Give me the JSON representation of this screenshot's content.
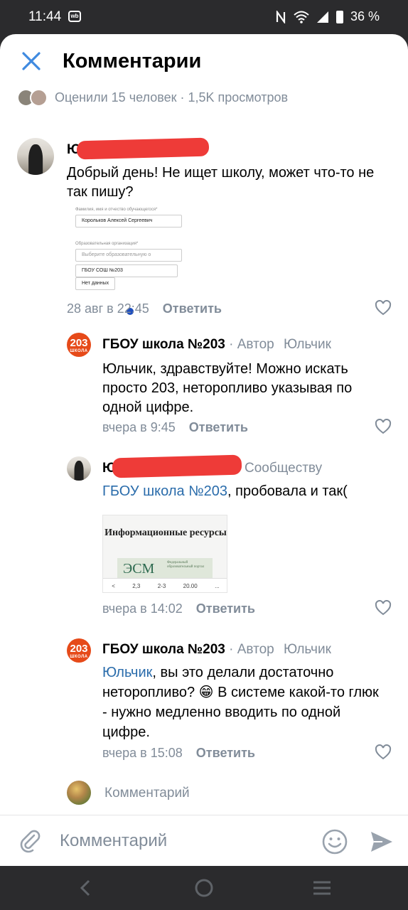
{
  "status_bar": {
    "time": "11:44",
    "app_badge": "wb",
    "battery": "36 %"
  },
  "header": {
    "title": "Комментарии"
  },
  "meta": {
    "text": "Оценили 15 человек · 1,5K просмотров"
  },
  "comments": [
    {
      "author_visible": "Юл",
      "text": "Добрый день! Не ищет школу, может что-то не так пишу?",
      "time": "28 авг в 22:45",
      "reply_label": "Ответить",
      "attachment": {
        "label_name": "Фамилия, имя и отчество обучающегося*",
        "value_name": "Корольков Алексей Сергеевич",
        "label_org": "Образовательная организация*",
        "placeholder_org": "Выберите образовательную о",
        "typed": "ГБОУ СОШ №203",
        "no_data": "Нет данных"
      }
    },
    {
      "author": "ГБОУ школа №203",
      "role": "· Автор",
      "reply_to": "Юльчик",
      "avatar_num": "203",
      "avatar_word": "ШКОЛА",
      "text": "Юльчик, здравствуйте! Можно искать просто 203, неторопливо указывая по одной цифре.",
      "time": "вчера в 9:45",
      "reply_label": "Ответить"
    },
    {
      "author_visible": "Ю",
      "role": "Сообществу",
      "mention": "ГБОУ школа №203",
      "text_rest": ", пробовала и так(",
      "time": "вчера в 14:02",
      "reply_label": "Ответить",
      "attachment": {
        "title": "Информационные ресурсы",
        "card": "ЭСМ",
        "card_small": "Федеральный образовательный портал",
        "bar": [
          "<",
          "2,3",
          "2-3",
          "20.00",
          "..."
        ]
      }
    },
    {
      "author": "ГБОУ школа №203",
      "role": "· Автор",
      "reply_to": "Юльчик",
      "avatar_num": "203",
      "avatar_word": "ШКОЛА",
      "mention": "Юльчик",
      "text_rest": ", вы это делали достаточно неторопливо? 😁 В системе какой-то глюк - нужно медленно вводить по одной цифре.",
      "time": "вчера в 15:08",
      "reply_label": "Ответить"
    }
  ],
  "preview": {
    "placeholder": "Комментарий"
  },
  "input_bar": {
    "placeholder": "Комментарий"
  },
  "colors": {
    "accent": "#3f8ae0",
    "link": "#2a6cab",
    "secondary_text": "#818c99",
    "school_brand": "#e64a19",
    "redaction": "#ee3b38"
  },
  "icons": [
    "close-icon",
    "heart-icon",
    "paperclip-icon",
    "emoji-icon",
    "send-icon",
    "back-icon",
    "home-icon",
    "recents-icon",
    "wifi-icon",
    "signal-icon",
    "battery-icon",
    "nfc-icon"
  ]
}
